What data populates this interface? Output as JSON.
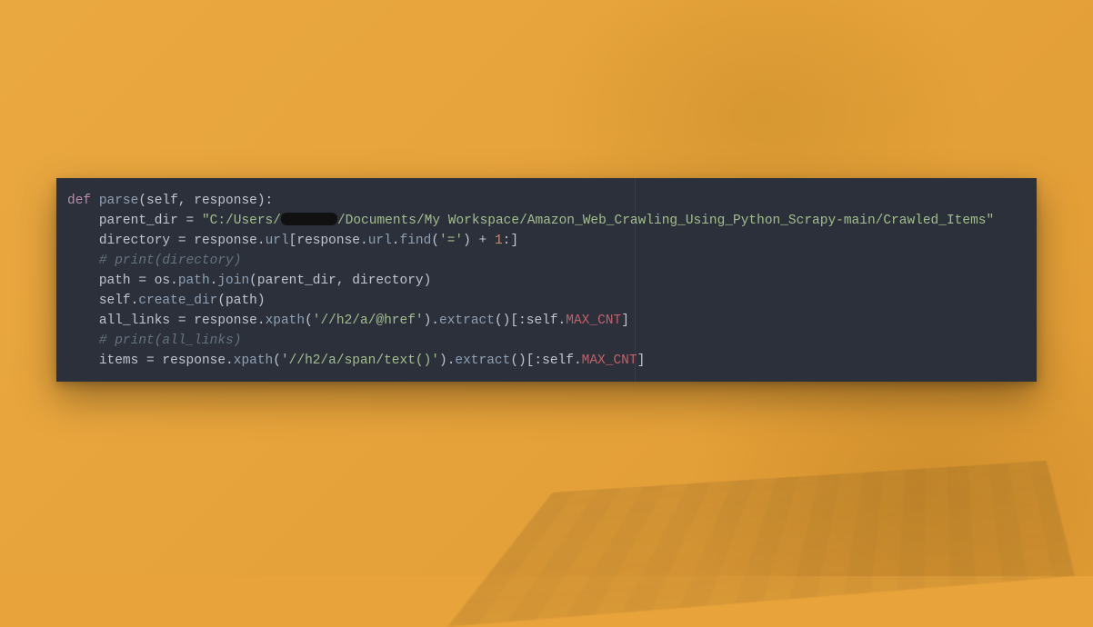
{
  "code": {
    "line1": {
      "def": "def",
      "name": "parse",
      "params": "(self, response):"
    },
    "line2": {
      "lhs": "parent_dir",
      "eq": " = ",
      "str_a": "\"C:/Users/",
      "str_b": "/Documents/My Workspace/Amazon_Web_Crawling_Using_Python_Scrapy-main/Crawled_Items\""
    },
    "line3": {
      "lhs": "directory",
      "eq": " = response.",
      "attr1": "url",
      "mid1": "[response.",
      "attr2": "url",
      "dot": ".",
      "find": "find",
      "open": "(",
      "arg": "'='",
      "close": ") + ",
      "one": "1",
      "tail": ":]"
    },
    "line4": {
      "comment": "# print(directory)"
    },
    "line5": {
      "lhs": "path",
      "eq": " = os.",
      "path": "path",
      "dot": ".",
      "join": "join",
      "args": "(parent_dir, directory)"
    },
    "line6": {
      "self": "self.",
      "method": "create_dir",
      "args": "(path)"
    },
    "line7": {
      "lhs": "all_links",
      "eq": " = response.",
      "xpath": "xpath",
      "open": "(",
      "arg": "'//h2/a/@href'",
      "close": ").",
      "extract": "extract",
      "tail1": "()[:self.",
      "const": "MAX_CNT",
      "tail2": "]"
    },
    "line8": {
      "comment": "# print(all_links)"
    },
    "line9": {
      "lhs": "items",
      "eq": " = response.",
      "xpath": "xpath",
      "open": "(",
      "arg": "'//h2/a/span/text()'",
      "close": ").",
      "extract": "extract",
      "tail1": "()[:self.",
      "const": "MAX_CNT",
      "tail2": "]"
    }
  }
}
